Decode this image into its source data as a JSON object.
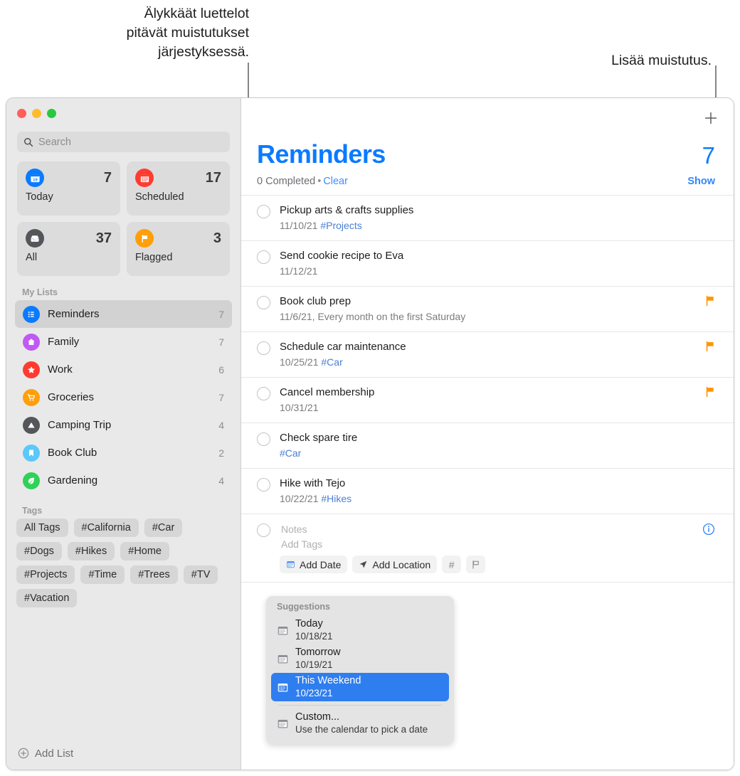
{
  "callouts": {
    "lists": "Älykkäät luettelot\npitävät muistutukset\njärjestyksessä.",
    "add": "Lisää muistutus."
  },
  "sidebar": {
    "search": {
      "placeholder": "Search",
      "icon": "search-icon"
    },
    "smart_lists": [
      {
        "label": "Today",
        "count": "7",
        "icon": "calendar-today-icon",
        "color": "#0a7bff",
        "glyph": "19"
      },
      {
        "label": "Scheduled",
        "count": "17",
        "icon": "calendar-scheduled-icon",
        "color": "#ff3b30",
        "glyph": ""
      },
      {
        "label": "All",
        "count": "37",
        "icon": "tray-icon",
        "color": "#55565a",
        "glyph": ""
      },
      {
        "label": "Flagged",
        "count": "3",
        "icon": "flag-icon",
        "color": "#ff9f0a",
        "glyph": ""
      }
    ],
    "my_lists_header": "My Lists",
    "my_lists": [
      {
        "label": "Reminders",
        "count": "7",
        "icon": "list-bullet-icon",
        "color": "#0a7bff",
        "selected": true
      },
      {
        "label": "Family",
        "count": "7",
        "icon": "house-icon",
        "color": "#bf5af2",
        "selected": false
      },
      {
        "label": "Work",
        "count": "6",
        "icon": "star-icon",
        "color": "#ff3b30",
        "selected": false
      },
      {
        "label": "Groceries",
        "count": "7",
        "icon": "cart-icon",
        "color": "#ff9f0a",
        "selected": false
      },
      {
        "label": "Camping Trip",
        "count": "4",
        "icon": "tent-icon",
        "color": "#55565a",
        "selected": false
      },
      {
        "label": "Book Club",
        "count": "2",
        "icon": "bookmark-icon",
        "color": "#5ac8fa",
        "selected": false
      },
      {
        "label": "Gardening",
        "count": "4",
        "icon": "leaf-icon",
        "color": "#30d158",
        "selected": false
      }
    ],
    "tags_header": "Tags",
    "tags": [
      "All Tags",
      "#California",
      "#Car",
      "#Dogs",
      "#Hikes",
      "#Home",
      "#Projects",
      "#Time",
      "#Trees",
      "#TV",
      "#Vacation"
    ],
    "add_list_label": "Add List",
    "add_list_icon": "plus-circle-icon"
  },
  "main": {
    "add_reminder_icon": "plus-icon",
    "title": "Reminders",
    "title_count": "7",
    "completed_text": "0 Completed",
    "separator_dot": "•",
    "clear_label": "Clear",
    "show_label": "Show",
    "reminders": [
      {
        "title": "Pickup arts & crafts supplies",
        "date": "11/10/21",
        "tag": "#Projects",
        "flagged": false
      },
      {
        "title": "Send cookie recipe to Eva",
        "date": "11/12/21",
        "tag": "",
        "flagged": false
      },
      {
        "title": "Book club prep",
        "date": "11/6/21, Every month on the first Saturday",
        "tag": "",
        "flagged": true
      },
      {
        "title": "Schedule car maintenance",
        "date": "10/25/21",
        "tag": "#Car",
        "flagged": true
      },
      {
        "title": "Cancel membership",
        "date": "10/31/21",
        "tag": "",
        "flagged": true
      },
      {
        "title": "Check spare tire",
        "date": "",
        "tag": "#Car",
        "flagged": false
      },
      {
        "title": "Hike with Tejo",
        "date": "10/22/21",
        "tag": "#Hikes",
        "flagged": false
      }
    ],
    "editor": {
      "notes_placeholder": "Notes",
      "tags_placeholder": "Add Tags",
      "add_date_label": "Add Date",
      "add_date_icon": "calendar-icon",
      "add_location_label": "Add Location",
      "add_location_icon": "location-arrow-icon",
      "hash_label": "#",
      "flag_icon": "flag-outline-icon",
      "info_icon": "info-circle-icon"
    }
  },
  "suggestions": {
    "header": "Suggestions",
    "items": [
      {
        "label": "Today",
        "date": "10/18/21",
        "icon": "calendar-icon",
        "selected": false
      },
      {
        "label": "Tomorrow",
        "date": "10/19/21",
        "icon": "calendar-icon",
        "selected": false
      },
      {
        "label": "This Weekend",
        "date": "10/23/21",
        "icon": "calendar-icon",
        "selected": true
      },
      {
        "label": "Custom...",
        "date": "Use the calendar to pick a date",
        "icon": "calendar-icon",
        "selected": false
      }
    ]
  },
  "colors": {
    "accent_blue": "#0a7bff",
    "link_blue": "#3c8fff",
    "flag_orange": "#ff9500",
    "selection_blue": "#2f7eef",
    "sidebar_bg": "#e9e9e9"
  }
}
